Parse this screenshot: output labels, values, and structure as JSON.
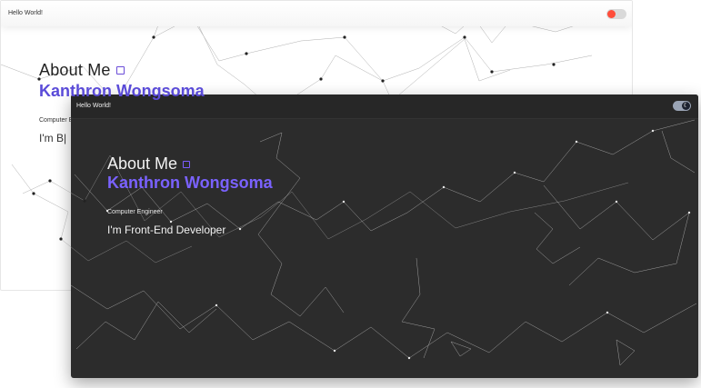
{
  "light": {
    "brand": "Hello World!",
    "about": "About Me",
    "name": "Kanthron Wongsoma",
    "role": "Computer E",
    "tagline": "I'm B|",
    "colors": {
      "accent": "#5a4bd8",
      "toggle_knob": "#ff4d3a"
    },
    "icons": {
      "edit": "edit-icon",
      "toggle": "theme-toggle-icon"
    }
  },
  "dark": {
    "brand": "Hello World!",
    "about": "About Me",
    "name": "Kanthron Wongsoma",
    "role": "Computer Engineer",
    "tagline": "I'm Front-End Developer",
    "colors": {
      "accent": "#7a62ff",
      "bg": "#2c2c2c"
    },
    "icons": {
      "edit": "edit-icon",
      "toggle": "moon-icon"
    }
  }
}
